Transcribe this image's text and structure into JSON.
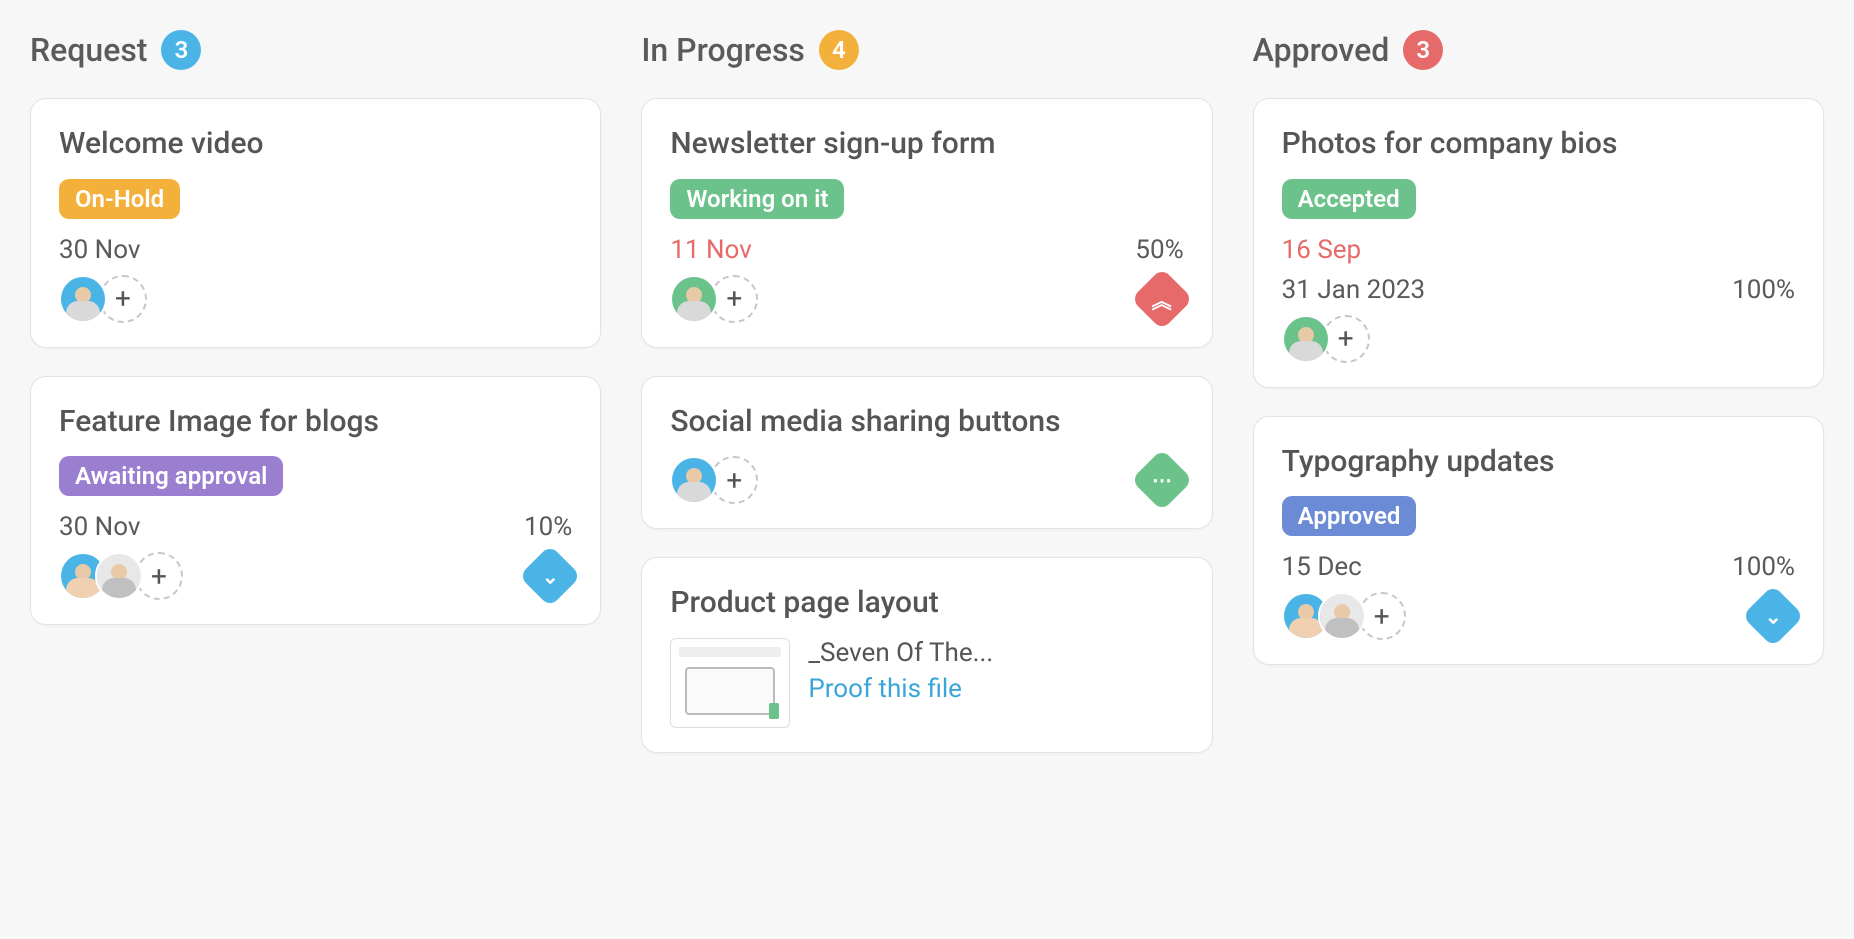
{
  "columns": [
    {
      "title": "Request",
      "count": "3",
      "count_color": "count-blue",
      "cards": [
        {
          "title": "Welcome video",
          "status": {
            "label": "On-Hold",
            "color": "pill-orange"
          },
          "date": "30 Nov",
          "date_overdue": false,
          "avatars": [
            {
              "bg": "#4ab4e6",
              "body": "#d9d9d9"
            }
          ],
          "show_add": true
        },
        {
          "title": "Feature Image for blogs",
          "status": {
            "label": "Awaiting approval",
            "color": "pill-purple"
          },
          "date": "30 Nov",
          "date_overdue": false,
          "percent": "10%",
          "avatars": [
            {
              "bg": "#4ab4e6",
              "body": "#f0d0b0"
            },
            {
              "bg": "#e8e8e8",
              "body": "#c0c0c0"
            }
          ],
          "show_add": true,
          "priority": {
            "color": "pri-blue",
            "glyph": "⌄"
          }
        }
      ]
    },
    {
      "title": "In Progress",
      "count": "4",
      "count_color": "count-orange",
      "cards": [
        {
          "title": "Newsletter sign-up form",
          "status": {
            "label": "Working on it",
            "color": "pill-green"
          },
          "date": "11 Nov",
          "date_overdue": true,
          "percent": "50%",
          "avatars": [
            {
              "bg": "#6bc28a",
              "body": "#d9d9d9"
            }
          ],
          "show_add": true,
          "priority": {
            "color": "pri-red",
            "glyph": "︽"
          }
        },
        {
          "title": "Social media sharing buttons",
          "avatars": [
            {
              "bg": "#4ab4e6",
              "body": "#d9d9d9"
            }
          ],
          "show_add": true,
          "priority": {
            "color": "pri-green",
            "glyph": "⋯"
          }
        },
        {
          "title": "Product page layout",
          "attachment": {
            "name": "_Seven Of The...",
            "action": "Proof this file"
          }
        }
      ]
    },
    {
      "title": "Approved",
      "count": "3",
      "count_color": "count-red",
      "cards": [
        {
          "title": "Photos for company bios",
          "status": {
            "label": "Accepted",
            "color": "pill-green"
          },
          "date": "16 Sep",
          "date_overdue": true,
          "date2": "31 Jan 2023",
          "percent": "100%",
          "avatars": [
            {
              "bg": "#6bc28a",
              "body": "#d9d9d9"
            }
          ],
          "show_add": true
        },
        {
          "title": "Typography updates",
          "status": {
            "label": "Approved",
            "color": "pill-blue"
          },
          "date": "15 Dec",
          "date_overdue": false,
          "percent": "100%",
          "avatars": [
            {
              "bg": "#4ab4e6",
              "body": "#f0d0b0"
            },
            {
              "bg": "#e8e8e8",
              "body": "#c0c0c0"
            }
          ],
          "show_add": true,
          "priority": {
            "color": "pri-blue",
            "glyph": "⌄"
          }
        }
      ]
    }
  ]
}
